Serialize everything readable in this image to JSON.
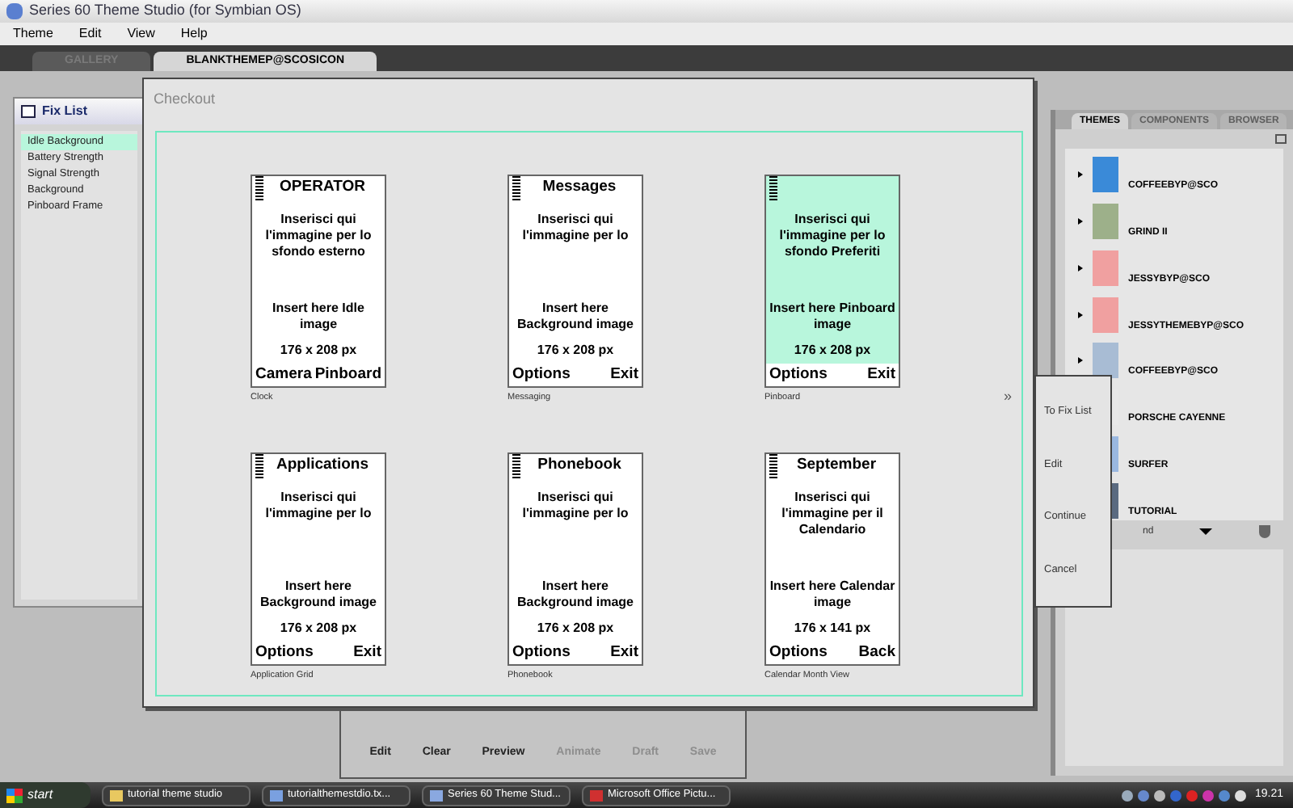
{
  "window": {
    "title": "Series 60 Theme Studio (for Symbian OS)"
  },
  "menu": [
    "Theme",
    "Edit",
    "View",
    "Help"
  ],
  "tabs": [
    {
      "label": "GALLERY",
      "selected": false
    },
    {
      "label": "BLANKTHEMEP@SCOSICON",
      "selected": true
    }
  ],
  "fix_list": {
    "title": "Fix List",
    "items": [
      {
        "label": "Idle Background",
        "selected": true
      },
      {
        "label": "Battery Strength",
        "selected": false
      },
      {
        "label": "Signal Strength",
        "selected": false
      },
      {
        "label": "Background",
        "selected": false
      },
      {
        "label": "Pinboard Frame",
        "selected": false
      }
    ]
  },
  "checkout": {
    "title": "Checkout",
    "more": "»",
    "screens": [
      {
        "title": "OPERATOR",
        "italian": "Inserisci qui l'immagine per lo sfondo esterno",
        "english": "Insert here Idle image",
        "size": "176 x 208 px",
        "left_soft": "Camera",
        "right_soft": "Pinboard",
        "caption": "Clock",
        "highlighted": false
      },
      {
        "title": "Messages",
        "italian": "Inserisci qui l'immagine per lo",
        "english": "Insert here Background image",
        "size": "176 x 208 px",
        "left_soft": "Options",
        "right_soft": "Exit",
        "caption": "Messaging",
        "highlighted": false
      },
      {
        "italian": "Inserisci qui l'immagine per lo sfondo Preferiti",
        "english": "Insert here Pinboard image",
        "size": "176 x 208 px",
        "left_soft": "Options",
        "right_soft": "Exit",
        "caption": "Pinboard",
        "highlighted": true
      },
      {
        "title": "Applications",
        "italian": "Inserisci qui l'immagine per lo",
        "english": "Insert here Background image",
        "size": "176 x 208 px",
        "left_soft": "Options",
        "right_soft": "Exit",
        "caption": "Application Grid",
        "highlighted": false
      },
      {
        "title": "Phonebook",
        "italian": "Inserisci qui l'immagine per lo",
        "english": "Insert here Background image",
        "size": "176 x 208 px",
        "left_soft": "Options",
        "right_soft": "Exit",
        "caption": "Phonebook",
        "highlighted": false
      },
      {
        "title": "September",
        "italian": "Inserisci qui l'immagine per il Calendario",
        "english": "Insert here Calendar image",
        "size": "176 x 141 px",
        "left_soft": "Options",
        "right_soft": "Back",
        "caption": "Calendar Month View",
        "highlighted": false
      }
    ]
  },
  "side_menu": [
    "To Fix List",
    "Edit",
    "Continue",
    "Cancel"
  ],
  "theme_panel": {
    "tabs": [
      {
        "label": "THEMES",
        "selected": true
      },
      {
        "label": "COMPONENTS",
        "selected": false
      },
      {
        "label": "BROWSER",
        "selected": false
      }
    ],
    "themes": [
      "COFFEEBYP@SCO",
      "GRIND II",
      "JESSYBYP@SCO",
      "JESSYTHEMEBYP@SCO",
      "COFFEEBYP@SCO",
      "PORSCHE CAYENNE",
      "SURFER",
      "TUTORIAL"
    ],
    "footer": "nd"
  },
  "toolbar": [
    {
      "label": "Edit",
      "disabled": false
    },
    {
      "label": "Clear",
      "disabled": false
    },
    {
      "label": "Preview",
      "disabled": false
    },
    {
      "label": "Animate",
      "disabled": true
    },
    {
      "label": "Draft",
      "disabled": true
    },
    {
      "label": "Save",
      "disabled": true
    }
  ],
  "taskbar": {
    "start": "start",
    "tasks": [
      "tutorial theme studio",
      "tutorialthemestdio.tx...",
      "Series 60 Theme Stud...",
      "Microsoft Office Pictu..."
    ],
    "clock": "19.21"
  }
}
